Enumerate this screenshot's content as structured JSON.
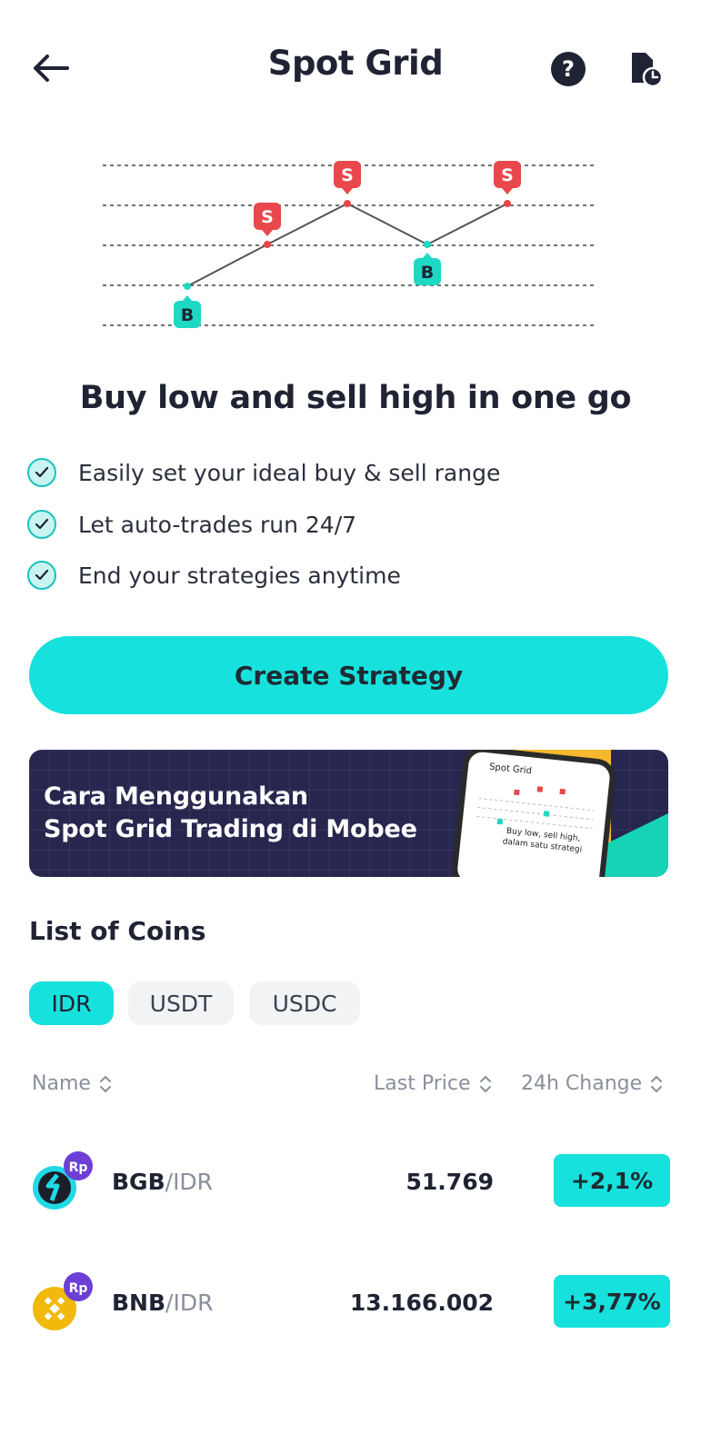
{
  "header": {
    "title": "Spot Grid"
  },
  "illustration": {
    "buy_label": "B",
    "sell_label": "S"
  },
  "headline": "Buy low and sell high in one go",
  "features": [
    "Easily set your ideal buy & sell range",
    "Let auto-trades run 24/7",
    "End your strategies anytime"
  ],
  "cta_label": "Create Strategy",
  "banner": {
    "line1": "Cara Menggunakan",
    "line2": "Spot Grid Trading di Mobee",
    "phone_title": "Spot Grid",
    "phone_text1": "Buy low, sell high,",
    "phone_text2": "dalam satu strategi"
  },
  "coins_section": {
    "title": "List of Coins",
    "tabs": [
      "IDR",
      "USDT",
      "USDC"
    ],
    "active_tab": "IDR",
    "columns": {
      "name": "Name",
      "last_price": "Last Price",
      "change": "24h Change"
    },
    "rows": [
      {
        "base": "BGB",
        "quote": "/IDR",
        "price": "51.769",
        "change": "+2,1%",
        "badge": "Rp"
      },
      {
        "base": "BNB",
        "quote": "/IDR",
        "price": "13.166.002",
        "change": "+3,77%",
        "badge": "Rp"
      }
    ]
  },
  "colors": {
    "accent": "#17e1dc",
    "sell": "#e8484b",
    "buy": "#1ed8c3",
    "banner_bg": "#27264f"
  }
}
